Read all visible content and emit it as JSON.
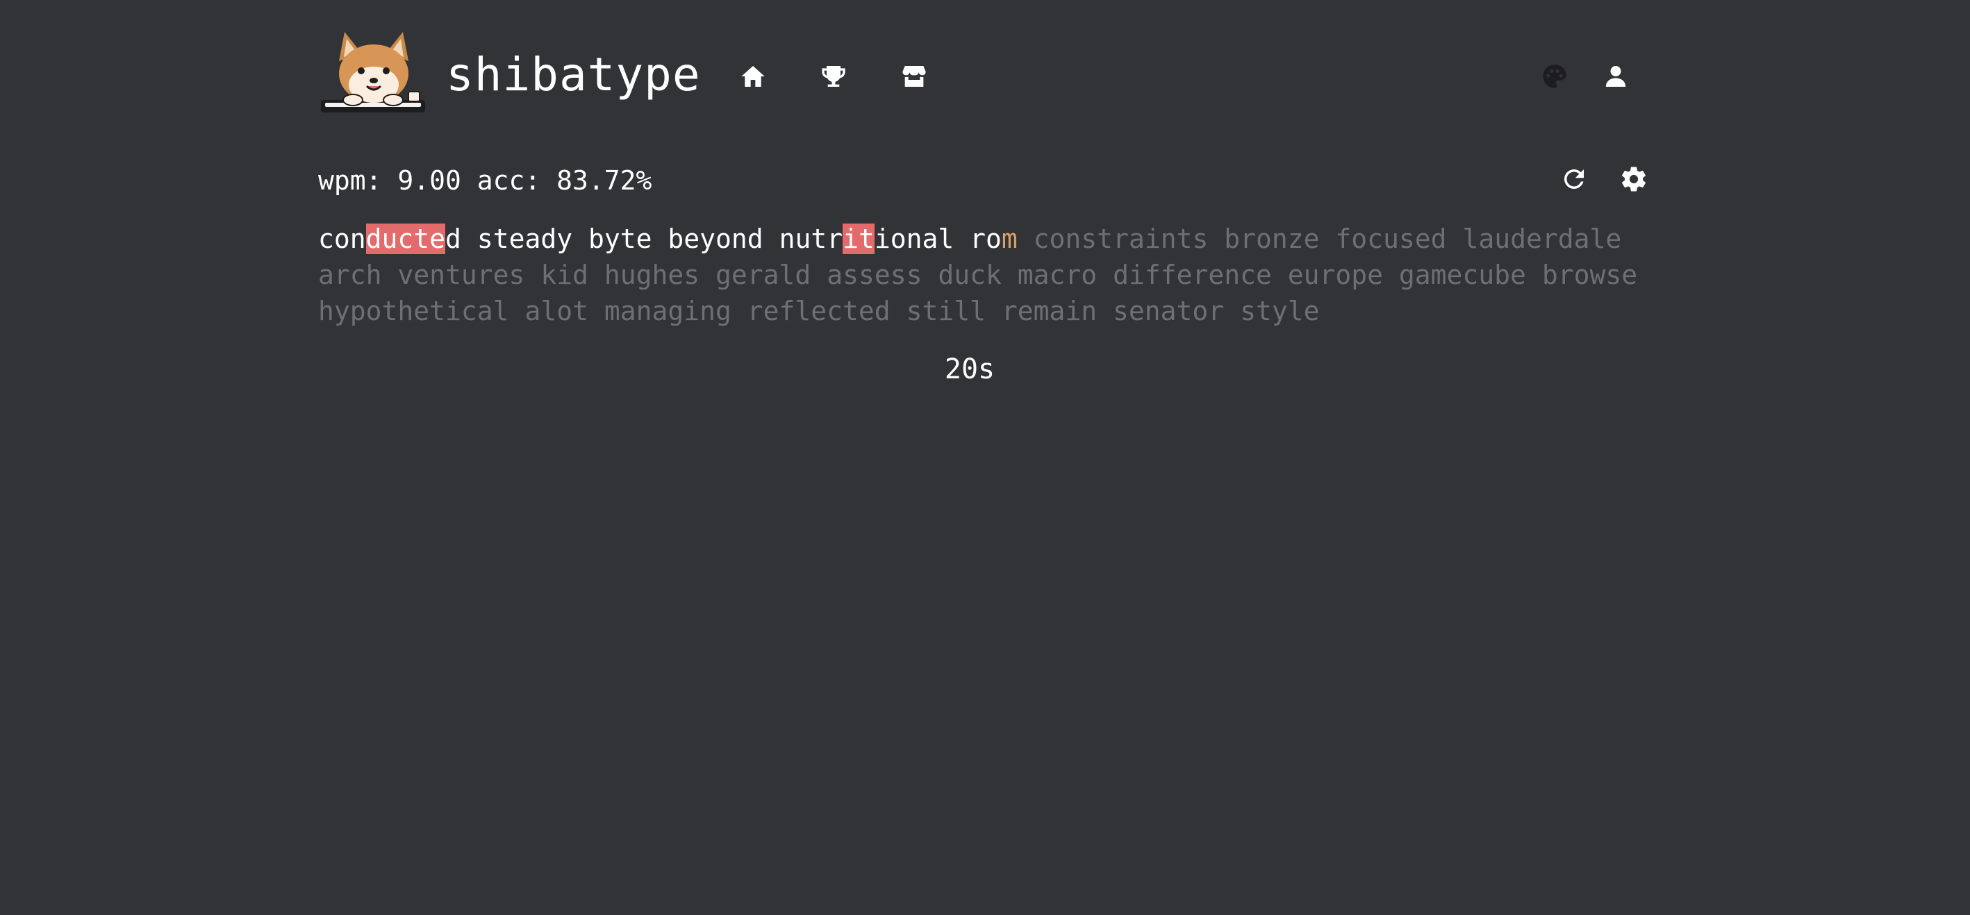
{
  "app": {
    "brand": "shibatype"
  },
  "nav": {
    "items": [
      {
        "name": "home",
        "icon": "home-icon"
      },
      {
        "name": "leaderboard",
        "icon": "trophy-icon"
      },
      {
        "name": "store",
        "icon": "store-icon"
      },
      {
        "name": "theme",
        "icon": "palette-icon"
      },
      {
        "name": "account",
        "icon": "user-icon"
      }
    ]
  },
  "stats": {
    "text": "wpm: 9.00 acc: 83.72%"
  },
  "controls": {
    "restart_icon": "restart-icon",
    "settings_icon": "gear-icon"
  },
  "test": {
    "typed": [
      {
        "segments": [
          [
            "con",
            "typed"
          ],
          [
            "ducte",
            "err"
          ],
          [
            "d",
            "typed"
          ]
        ]
      },
      {
        "segments": [
          [
            "steady",
            "typed"
          ]
        ]
      },
      {
        "segments": [
          [
            "byte",
            "typed"
          ]
        ]
      },
      {
        "segments": [
          [
            "beyond",
            "typed"
          ]
        ]
      },
      {
        "segments": [
          [
            "nutr",
            "typed"
          ],
          [
            "it",
            "err"
          ],
          [
            "ional",
            "typed"
          ]
        ]
      },
      {
        "segments": [
          [
            "ro",
            "typed"
          ],
          [
            "m",
            "caret"
          ]
        ]
      }
    ],
    "upcoming": [
      "constraints",
      "bronze",
      "focused",
      "lauderdale",
      "arch",
      "ventures",
      "kid",
      "hughes",
      "gerald",
      "assess",
      "duck",
      "macro",
      "difference",
      "europe",
      "gamecube",
      "browse",
      "hypothetical",
      "alot",
      "managing",
      "reflected",
      "still",
      "remain",
      "senator",
      "style"
    ],
    "timer": "20s"
  },
  "colors": {
    "background": "#323337",
    "text": "#ffffff",
    "untyped": "#6e6f73",
    "error_bg": "#e46b6b",
    "caret": "#d9a06a"
  }
}
